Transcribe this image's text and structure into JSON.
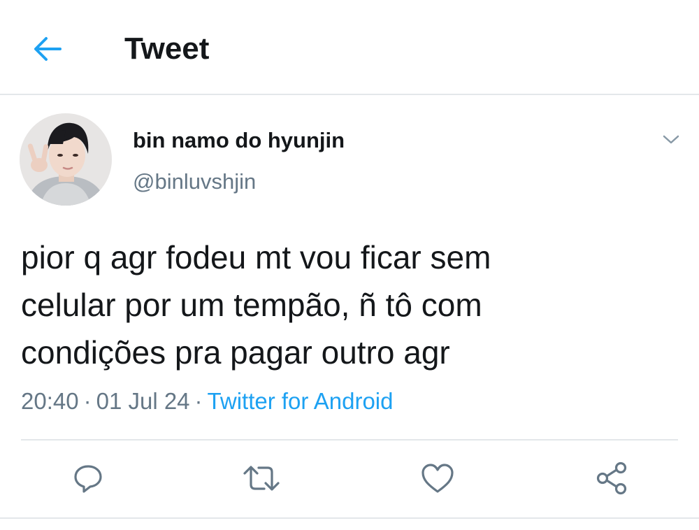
{
  "header": {
    "title": "Tweet",
    "back_icon": "arrow-left-icon"
  },
  "author": {
    "display_name": "bin namo do hyunjin",
    "handle": "@binluvshjin"
  },
  "tweet": {
    "text_lines": [
      "pior q agr fodeu mt vou ficar sem",
      "celular por um tempão, ñ tô com",
      "condições pra pagar outro agr"
    ],
    "time": "20:40",
    "date": "01 Jul 24",
    "separator": "·",
    "source": "Twitter for Android"
  },
  "actions": [
    "reply-icon",
    "retweet-icon",
    "like-icon",
    "share-icon"
  ],
  "colors": {
    "accent": "#1da1f2",
    "text": "#14171a",
    "muted": "#657786",
    "icon": "#657786",
    "border": "#e3e7ea"
  }
}
